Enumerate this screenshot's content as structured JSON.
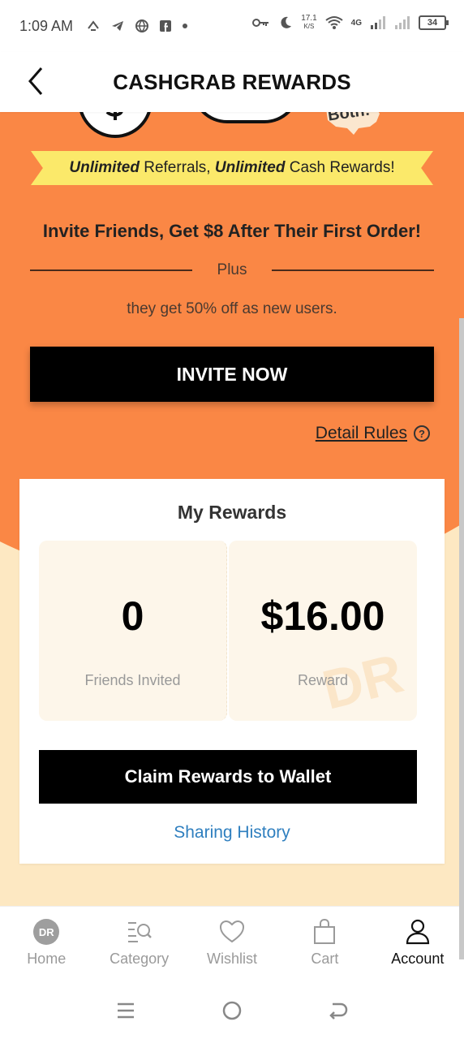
{
  "status_bar": {
    "time": "1:09 AM",
    "speed_value": "17.1",
    "speed_unit": "K/S",
    "network": "4G",
    "battery": "34"
  },
  "header": {
    "title": "CASHGRAB REWARDS"
  },
  "banner": {
    "ribbon_part1": "Unlimited",
    "ribbon_part2": " Referrals, ",
    "ribbon_part3": "Unlimited",
    "ribbon_part4": " Cash Rewards!",
    "invite_title": "Invite Friends, Get $8 After Their First Order!",
    "plus_label": "Plus",
    "sub_text": "they get 50% off as new users.",
    "invite_button": "INVITE NOW",
    "detail_rules": "Detail Rules",
    "deco_text": "Both!"
  },
  "rewards": {
    "title": "My Rewards",
    "friends_invited_value": "0",
    "friends_invited_label": "Friends Invited",
    "reward_value": "$16.00",
    "reward_label": "Reward",
    "watermark": "DR",
    "claim_button": "Claim Rewards to Wallet",
    "history_link": "Sharing History"
  },
  "bottom_nav": {
    "items": [
      {
        "label": "Home",
        "icon": "dr-logo-icon",
        "badge": "DR"
      },
      {
        "label": "Category",
        "icon": "category-search-icon"
      },
      {
        "label": "Wishlist",
        "icon": "heart-icon"
      },
      {
        "label": "Cart",
        "icon": "shopping-bag-icon"
      },
      {
        "label": "Account",
        "icon": "person-icon",
        "active": true
      }
    ]
  },
  "colors": {
    "orange": "#fa8745",
    "cream": "#fde8c2",
    "ribbon_yellow": "#fbe96a",
    "link_blue": "#2f7fbf"
  }
}
